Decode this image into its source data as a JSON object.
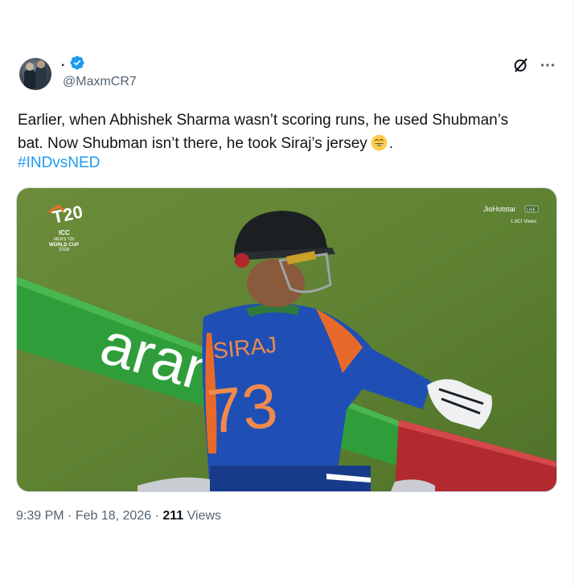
{
  "author": {
    "display_name": ".",
    "handle": "@MaxmCR7",
    "verified_color": "#1d9bf0"
  },
  "tweet": {
    "text_line1": "Earlier, when Abhishek Sharma wasn’t scoring runs, he used Shubman’s",
    "text_line2_before_emoji": "bat. Now Shubman isn’t there, he took Siraj’s jersey",
    "emoji": "grinning-face-emoji",
    "text_line2_after_emoji": ".",
    "hashtag": "#INDvsNED",
    "link_color": "#1d9bf0"
  },
  "media": {
    "logo_top": "T20",
    "logo_icc": "ICC",
    "logo_line1": "MEN'S T20",
    "logo_line2": "WORLD CUP",
    "logo_year": "2026",
    "broadcaster": "JioHotstar",
    "live_badge": "LIVE",
    "views_overlay": "1.9Cr Views",
    "board_text": "aran",
    "jersey_name": "SIRAJ",
    "jersey_number": "73"
  },
  "meta": {
    "time": "9:39 PM",
    "separator": "·",
    "date": "Feb 18, 2026",
    "views_count": "211",
    "views_label": "Views"
  },
  "icons": [
    "grok-icon",
    "more-icon",
    "verified-badge-icon"
  ]
}
